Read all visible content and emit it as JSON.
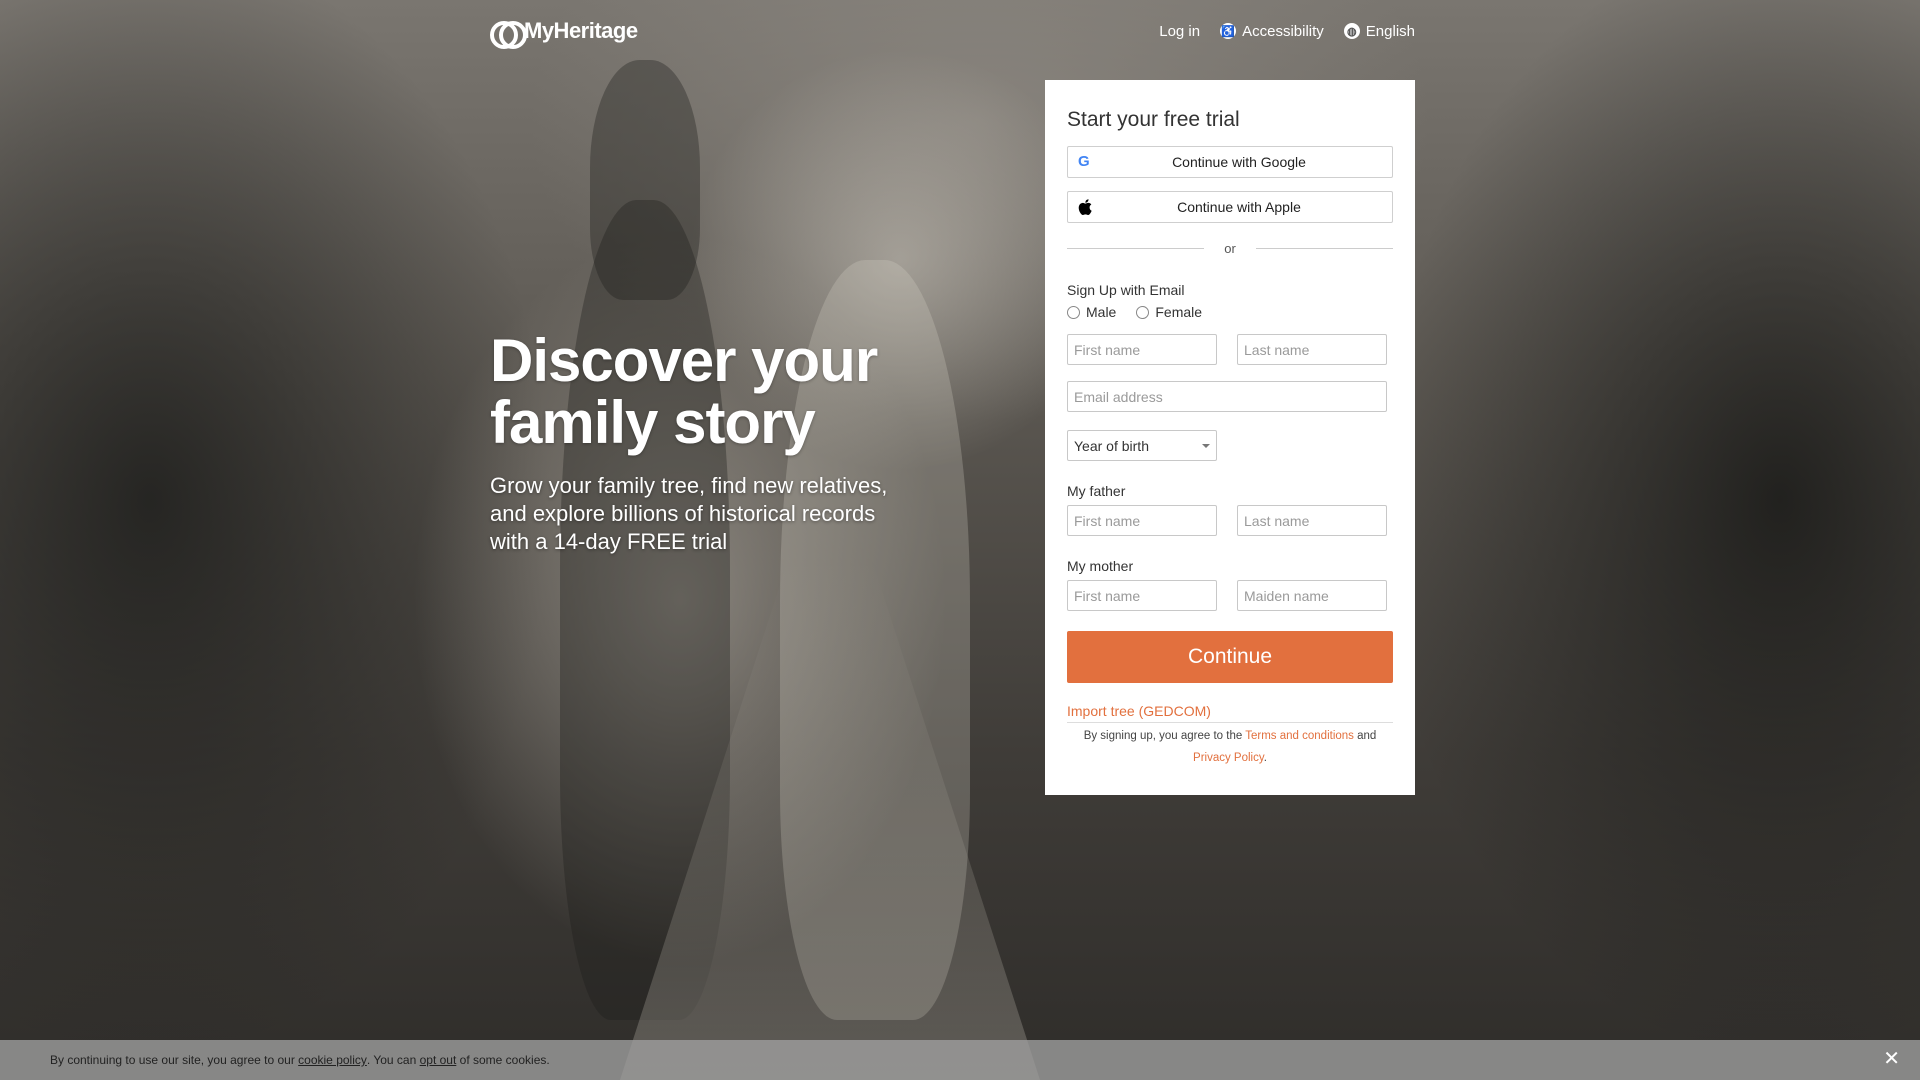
{
  "header": {
    "logo_text": "MyHeritage",
    "login": "Log in",
    "accessibility": "Accessibility",
    "language": "English"
  },
  "hero": {
    "title_line1": "Discover your",
    "title_line2": "family story",
    "subtitle_line1": "Grow your family tree, find new relatives,",
    "subtitle_line2": "and explore billions of historical records",
    "subtitle_line3": "with a 14-day FREE trial"
  },
  "form": {
    "title": "Start your free trial",
    "google": "Continue with Google",
    "apple": "Continue with Apple",
    "or": "or",
    "email_section": "Sign Up with Email",
    "gender_male": "Male",
    "gender_female": "Female",
    "first_name_ph": "First name",
    "last_name_ph": "Last name",
    "email_ph": "Email address",
    "year_of_birth": "Year of birth",
    "father_label": "My father",
    "father_first_ph": "First name",
    "father_last_ph": "Last name",
    "mother_label": "My mother",
    "mother_first_ph": "First name",
    "mother_maiden_ph": "Maiden name",
    "continue": "Continue",
    "import": "Import tree (GEDCOM)",
    "terms_prefix": "By signing up, you agree to the",
    "terms_link": "Terms and conditions",
    "terms_and": "and",
    "privacy_link": "Privacy Policy",
    "terms_end": "."
  },
  "cookie": {
    "text1": "By continuing to use our site, you agree to our",
    "cookie_link": "cookie policy",
    "text2": ". You can",
    "opt_out": "opt out",
    "text3": "of some cookies.",
    "close": "✕"
  },
  "colors": {
    "accent": "#e2703e"
  }
}
